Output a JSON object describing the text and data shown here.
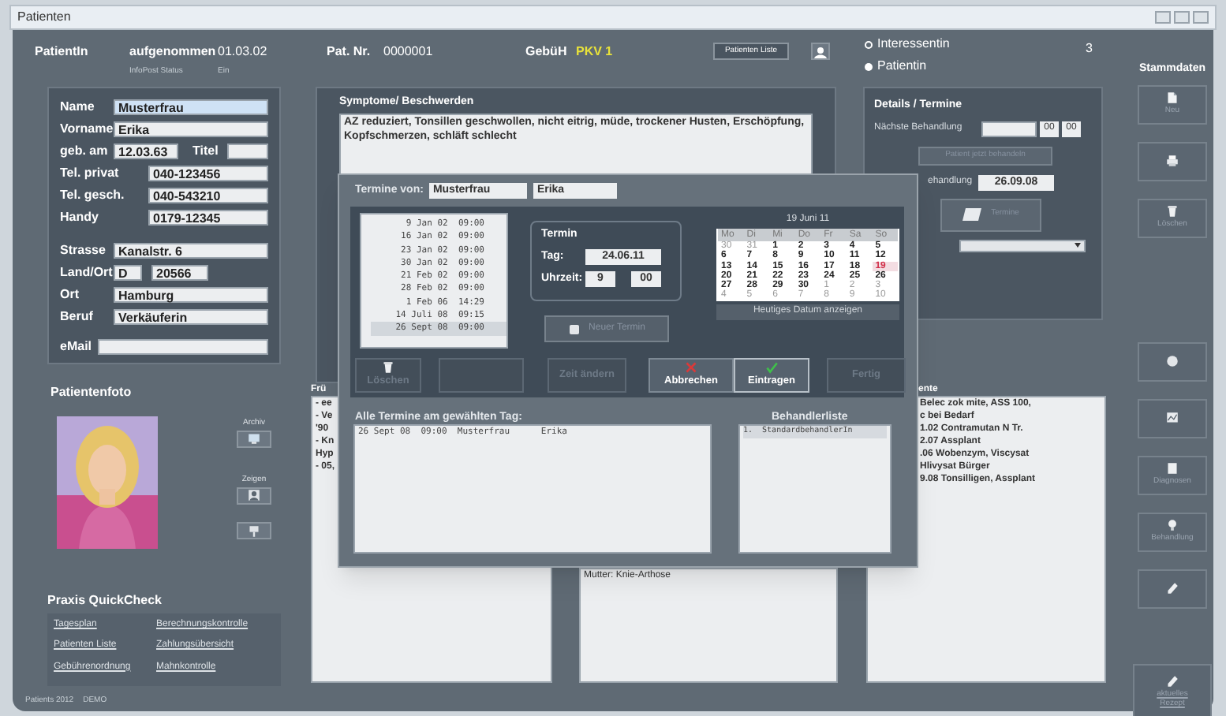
{
  "window": {
    "title": "Patienten"
  },
  "header": {
    "patient_label": "PatientIn",
    "admitted_label": "aufgenommen",
    "admitted_date": "01.03.02",
    "infopost_label": "InfoPost Status",
    "infopost_value": "Ein",
    "patno_label": "Pat. Nr.",
    "patno": "0000001",
    "fee_label": "GebüH",
    "fee_value": "PKV 1",
    "list_button": "Patienten Liste",
    "count": "3",
    "radios": [
      {
        "label": "Interessentin",
        "selected": false
      },
      {
        "label": "Patientin",
        "selected": true
      }
    ]
  },
  "personal": {
    "groups": [
      [
        {
          "kind": "text",
          "label": "Name",
          "value": "Musterfrau",
          "focused": true
        },
        {
          "kind": "text",
          "label": "Vorname",
          "value": "Erika",
          "focused": false
        },
        {
          "kind": "pair",
          "label": "geb. am",
          "value": "12.03.63",
          "label2": "Titel",
          "focused": false
        },
        {
          "kind": "phone",
          "label": "Tel. privat",
          "value": "040-123456",
          "focused": false
        },
        {
          "kind": "phone",
          "label": "Tel. gesch.",
          "value": "040-543210",
          "focused": false
        },
        {
          "kind": "phone",
          "label": "Handy",
          "value": "0179-12345",
          "focused": false
        }
      ],
      [
        {
          "kind": "text",
          "label": "Strasse",
          "value": "Kanalstr. 6",
          "focused": false
        },
        {
          "kind": "split",
          "label": "Land/Ort",
          "value": "D",
          "value2": "20566",
          "focused": false
        },
        {
          "kind": "text",
          "label": "Ort",
          "value": "Hamburg",
          "focused": false
        },
        {
          "kind": "text",
          "label": "Beruf",
          "value": "Verkäuferin",
          "focused": false
        }
      ],
      [
        {
          "kind": "text",
          "label": "eMail",
          "focused": false
        }
      ]
    ]
  },
  "photo": {
    "title": "Patientenfoto",
    "buttons": [
      {
        "label": "Archiv",
        "kind": "monitor"
      },
      {
        "label": "Zeigen",
        "kind": "person"
      },
      {
        "kind": "pin"
      }
    ]
  },
  "quickcheck": {
    "title": "Praxis QuickCheck",
    "links": [
      "Tagesplan",
      "Berechnungskontrolle",
      "Patienten Liste",
      "Zahlungsübersicht",
      "Gebührenordnung",
      "Mahnkontrolle"
    ]
  },
  "footer": {
    "product": "Patients 2012",
    "edition": "DEMO"
  },
  "symptoms": {
    "label": "Symptome/ Beschwerden",
    "text": "AZ reduziert, Tonsillen geschwollen, nicht eitrig, müde, trockener Husten, Erschöpfung, Kopfschmerzen, schläft schlecht"
  },
  "details": {
    "title": "Details / Termine",
    "next_label": "Nächste Behandlung",
    "next_hour": "00",
    "next_minute": "00",
    "treat_button": "Patient jetzt behandeln",
    "last_label": "ehandlung",
    "last_value": "26.09.08",
    "appointments_button": "Termine"
  },
  "history": {
    "label": "Frü",
    "lines": [
      "- ee",
      "- Ve",
      "'90",
      "- Kn",
      "Hyp",
      "- 05,"
    ]
  },
  "notes": {
    "text": "Mutter: Knie-Arthose"
  },
  "medication": {
    "label": "ente",
    "lines": [
      "Belec zok mite, ASS 100,",
      "c bei Bedarf",
      "1.02 Contramutan N Tr.",
      "2.07 Assplant",
      ".06 Wobenzym, Viscysat",
      "Hlivysat Bürger",
      "9.08 Tonsilligen, Assplant"
    ]
  },
  "sidebar": {
    "title": "Stammdaten",
    "buttons": [
      {
        "label": "Neu",
        "kind": "doc",
        "big": false
      },
      {
        "kind": "printer",
        "big": false
      },
      {
        "label": "Löschen",
        "kind": "trash",
        "big": false
      },
      {
        "kind": "ball",
        "big": false
      },
      {
        "kind": "chart",
        "big": false
      },
      {
        "label": "Diagnosen",
        "kind": "page",
        "big": false
      },
      {
        "label": "Behandlung",
        "kind": "bulb",
        "big": false
      },
      {
        "kind": "pen",
        "big": false
      },
      {
        "label": "aktuelles Rezept",
        "kind": "pen",
        "big": true
      }
    ]
  },
  "dialog": {
    "title_label": "Termine von:",
    "surname": "Musterfrau",
    "firstname": "Erika",
    "appointments": [
      {
        "text": "9 Jan 02  09:00",
        "selected": false
      },
      {
        "text": "16 Jan 02  09:00",
        "selected": false
      },
      {
        "text": "23 Jan 02  09:00",
        "selected": false
      },
      {
        "text": "30 Jan 02  09:00",
        "selected": false
      },
      {
        "text": "21 Feb 02  09:00",
        "selected": false
      },
      {
        "text": "28 Feb 02  09:00",
        "selected": false
      },
      {
        "text": "1 Feb 06  14:29",
        "selected": false
      },
      {
        "text": "14 Juli 08  09:15",
        "selected": false
      },
      {
        "text": "26 Sept 08  09:00",
        "selected": true
      }
    ],
    "termin": {
      "title": "Termin",
      "day_label": "Tag:",
      "day": "24.06.11",
      "time_label": "Uhrzeit:",
      "hour": "9",
      "minute": "00"
    },
    "new_button": "Neuer Termin",
    "calendar": {
      "heading": "19 Juni 11",
      "weekdays": [
        "Mo",
        "Di",
        "Mi",
        "Do",
        "Fr",
        "Sa",
        "So"
      ],
      "days": [
        {
          "day": "30",
          "kind": "other"
        },
        {
          "day": "31",
          "kind": "other"
        },
        {
          "day": "1",
          "kind": "cur"
        },
        {
          "day": "2",
          "kind": "cur"
        },
        {
          "day": "3",
          "kind": "cur"
        },
        {
          "day": "4",
          "kind": "cur"
        },
        {
          "day": "5",
          "kind": "cur"
        },
        {
          "day": "6",
          "kind": "cur"
        },
        {
          "day": "7",
          "kind": "cur"
        },
        {
          "day": "8",
          "kind": "cur"
        },
        {
          "day": "9",
          "kind": "cur"
        },
        {
          "day": "10",
          "kind": "cur"
        },
        {
          "day": "11",
          "kind": "cur"
        },
        {
          "day": "12",
          "kind": "cur"
        },
        {
          "day": "13",
          "kind": "cur"
        },
        {
          "day": "14",
          "kind": "cur"
        },
        {
          "day": "15",
          "kind": "cur"
        },
        {
          "day": "16",
          "kind": "cur"
        },
        {
          "day": "17",
          "kind": "cur"
        },
        {
          "day": "18",
          "kind": "cur"
        },
        {
          "day": "19",
          "kind": "today"
        },
        {
          "day": "20",
          "kind": "cur"
        },
        {
          "day": "21",
          "kind": "cur"
        },
        {
          "day": "22",
          "kind": "cur"
        },
        {
          "day": "23",
          "kind": "cur"
        },
        {
          "day": "24",
          "kind": "cur"
        },
        {
          "day": "25",
          "kind": "cur"
        },
        {
          "day": "26",
          "kind": "cur"
        },
        {
          "day": "27",
          "kind": "cur"
        },
        {
          "day": "28",
          "kind": "cur"
        },
        {
          "day": "29",
          "kind": "cur"
        },
        {
          "day": "30",
          "kind": "cur"
        },
        {
          "day": "1",
          "kind": "other"
        },
        {
          "day": "2",
          "kind": "other"
        },
        {
          "day": "3",
          "kind": "other"
        },
        {
          "day": "4",
          "kind": "other"
        },
        {
          "day": "5",
          "kind": "other"
        },
        {
          "day": "6",
          "kind": "other"
        },
        {
          "day": "7",
          "kind": "other"
        },
        {
          "day": "8",
          "kind": "other"
        },
        {
          "day": "9",
          "kind": "other"
        },
        {
          "day": "10",
          "kind": "other"
        }
      ],
      "today_button": "Heutiges Datum anzeigen"
    },
    "buttons": [
      {
        "label": "Löschen",
        "kind": "trash",
        "disabled": true,
        "primary": false
      },
      {
        "kind": "plain",
        "disabled": true,
        "primary": false
      },
      {
        "label": "Zeit ändern",
        "kind": "plain",
        "disabled": true,
        "primary": false
      },
      {
        "label": "Abbrechen",
        "kind": "cross",
        "disabled": false,
        "primary": false
      },
      {
        "label": "Eintragen",
        "kind": "check",
        "disabled": false,
        "primary": true
      },
      {
        "label": "Fertig",
        "kind": "plain",
        "disabled": true,
        "primary": false
      }
    ],
    "day_list_label": "Alle Termine am gewählten Tag:",
    "day_rows": [
      "26 Sept 08  09:00  Musterfrau      Erika"
    ],
    "staff_label": "Behandlerliste",
    "staff_rows": [
      "1.  StandardbehandlerIn"
    ]
  }
}
